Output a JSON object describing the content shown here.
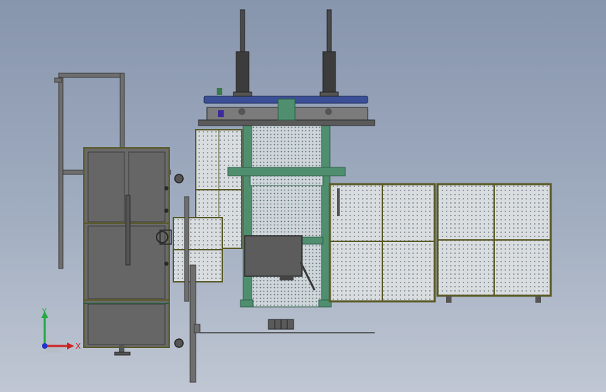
{
  "view": {
    "background_top": "#8795ad",
    "background_bottom": "#c0c7d3"
  },
  "colors": {
    "frame_green": "#4f8f6f",
    "frame_green_dark": "#2f5f48",
    "panel_border": "#5a5a28",
    "mesh_fill": "#d9dde0",
    "mesh_dot": "#5f6f7a",
    "steel_gray": "#6b6b6b",
    "dark_gray": "#4a4a4a",
    "platform_blue": "#3a4f96",
    "cylinder_dark": "#3c3c3c"
  },
  "axes_triad": {
    "x_label": "X",
    "y_label": "Y",
    "x_color": "#cc2222",
    "y_color": "#22aa44",
    "z_color": "#2233cc"
  }
}
